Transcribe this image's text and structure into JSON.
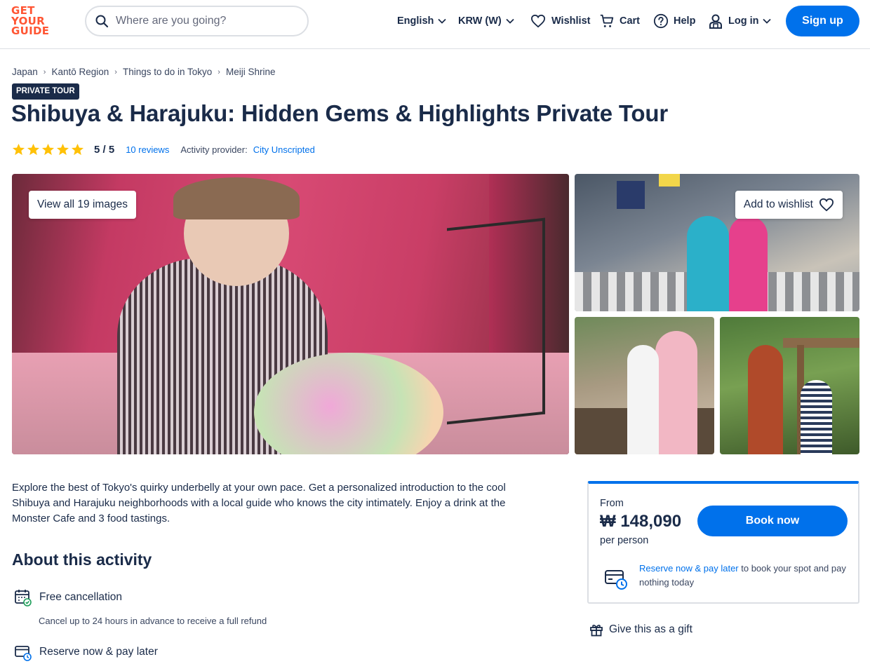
{
  "header": {
    "logo_lines": [
      "GET",
      "YOUR",
      "GUIDE"
    ],
    "search_placeholder": "Where are you going?",
    "nav": {
      "language": "English",
      "currency": "KRW (W)",
      "wishlist": "Wishlist",
      "cart": "Cart",
      "help": "Help",
      "login": "Log in"
    },
    "signup": "Sign up",
    "colors": {
      "brand": "#ff5533",
      "accent": "#0071eb",
      "text": "#1a2b49"
    }
  },
  "breadcrumb": [
    "Japan",
    "Kantō Region",
    "Things to do in Tokyo",
    "Meiji Shrine"
  ],
  "badge": "PRIVATE TOUR",
  "title": "Shibuya & Harajuku: Hidden Gems & Highlights Private Tour",
  "rating": {
    "stars": 5,
    "score": "5 / 5",
    "reviews": "10 reviews",
    "provider_label": "Activity provider:",
    "provider": "City Unscripted"
  },
  "gallery": {
    "view_all": "View all 19 images",
    "add_to_wishlist": "Add to wishlist"
  },
  "description": "Explore the best of Tokyo's quirky underbelly at your own pace. Get a personalized introduction to the cool Shibuya and Harajuku neighborhoods with a local guide who knows the city intimately. Enjoy a drink at the Monster Cafe and 3 food tastings.",
  "about": {
    "heading": "About this activity",
    "features": [
      {
        "icon": "calendar-check-icon",
        "title": "Free cancellation",
        "subtitle": "Cancel up to 24 hours in advance to receive a full refund"
      },
      {
        "icon": "card-clock-icon",
        "title": "Reserve now & pay later"
      }
    ]
  },
  "booking": {
    "from": "From",
    "price": "₩ 148,090",
    "per": "per person",
    "book_now": "Book now",
    "reserve_link": "Reserve now & pay later",
    "reserve_text": " to book your spot and pay nothing today"
  },
  "gift": "Give this as a gift"
}
